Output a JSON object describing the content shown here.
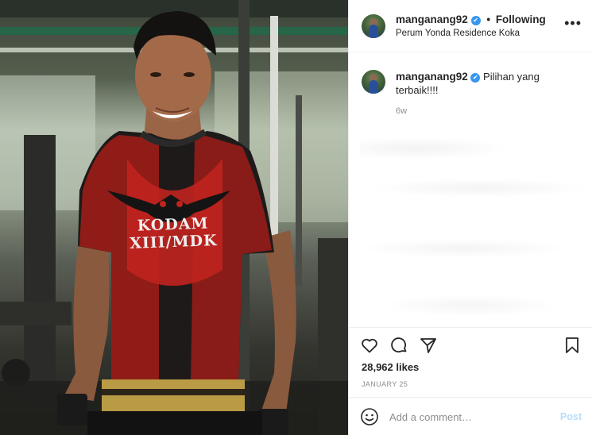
{
  "post": {
    "username": "manganang92",
    "verified_badge": "✔",
    "separator": "•",
    "follow_status": "Following",
    "location": "Perum Yonda Residence Koka",
    "more_icon": "more-horizontal-icon"
  },
  "caption": {
    "username": "manganang92",
    "verified_badge": "✔",
    "text": "Pilihan yang terbaik!!!!",
    "age": "6w"
  },
  "photo": {
    "shirt_text": "KODAM XIII/MDK"
  },
  "actions": {
    "icons": [
      "heart-icon",
      "comment-icon",
      "share-icon",
      "bookmark-icon"
    ],
    "likes": "28,962 likes",
    "date": "JANUARY 25"
  },
  "add_comment": {
    "emoji_icon": "smiley-icon",
    "placeholder": "Add a comment…",
    "post_label": "Post"
  },
  "colors": {
    "accent_blue": "#3897f0",
    "post_disabled": "#b2dffc",
    "muted_text": "#8e8e8e",
    "shirt_red": "#c0241e"
  }
}
